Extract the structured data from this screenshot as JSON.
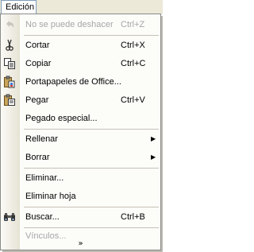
{
  "menubar": {
    "title": "Edición"
  },
  "menu": {
    "items": [
      {
        "label": "No se puede deshacer",
        "accel": "Ctrl+Z",
        "icon": "undo-icon",
        "disabled": true
      },
      {
        "label": "Cortar",
        "accel": "Ctrl+X",
        "icon": "scissors-icon"
      },
      {
        "label": "Copiar",
        "accel": "Ctrl+C",
        "icon": "copy-icon"
      },
      {
        "label": "Portapapeles de Office...",
        "accel": "",
        "icon": "clipboard-icon"
      },
      {
        "label": "Pegar",
        "accel": "Ctrl+V",
        "icon": "paste-icon"
      },
      {
        "label": "Pegado especial...",
        "accel": ""
      },
      {
        "label": "Rellenar",
        "submenu": true
      },
      {
        "label": "Borrar",
        "submenu": true
      },
      {
        "label": "Eliminar...",
        "accel": ""
      },
      {
        "label": "Eliminar hoja",
        "accel": ""
      },
      {
        "label": "Buscar...",
        "accel": "Ctrl+B",
        "icon": "binoculars-icon"
      },
      {
        "label": "Vínculos...",
        "accel": "",
        "disabled": true
      }
    ],
    "more_glyph": "»"
  }
}
